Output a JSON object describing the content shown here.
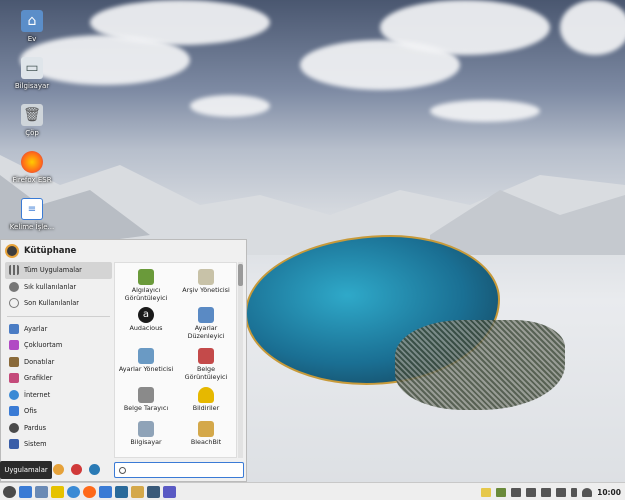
{
  "desktop": {
    "icons": [
      {
        "label": "Ev",
        "icon": "home-folder-icon",
        "color": "#5b8ec9"
      },
      {
        "label": "Bilgisayar",
        "icon": "computer-icon",
        "color": "#8fa3b8"
      },
      {
        "label": "Çöp",
        "icon": "trash-icon",
        "color": "#a9b1b8"
      },
      {
        "label": "Firefox ESR",
        "icon": "firefox-icon",
        "color": "#ff6a1a"
      },
      {
        "label": "Kelime İşle...",
        "icon": "document-icon",
        "color": "#3a7bd5"
      }
    ]
  },
  "menu": {
    "title": "Kütüphane",
    "top_categories": [
      {
        "label": "Tüm Uygulamalar",
        "icon": "grid-icon",
        "selected": true
      },
      {
        "label": "Sık kullanılanlar",
        "icon": "star-icon",
        "selected": false
      },
      {
        "label": "Son Kullanılanlar",
        "icon": "clock-icon",
        "selected": false
      }
    ],
    "categories": [
      {
        "label": "Ayarlar",
        "icon": "settings-icon",
        "color": "#4a7cc4"
      },
      {
        "label": "Çokluortam",
        "icon": "multimedia-icon",
        "color": "#b14ac4"
      },
      {
        "label": "Donatılar",
        "icon": "accessories-icon",
        "color": "#8a6a3a"
      },
      {
        "label": "Grafikler",
        "icon": "graphics-icon",
        "color": "#c44a7a"
      },
      {
        "label": "İnternet",
        "icon": "internet-icon",
        "color": "#3a8ad5"
      },
      {
        "label": "Ofis",
        "icon": "office-icon",
        "color": "#3a7bd5"
      },
      {
        "label": "Pardus",
        "icon": "pardus-icon",
        "color": "#4a4a4a"
      },
      {
        "label": "Sistem",
        "icon": "system-icon",
        "color": "#3a5ea8"
      }
    ],
    "apps": [
      {
        "label": "Algılayıcı Görüntüleyici",
        "icon": "sensor-viewer-icon",
        "color": "#6a9a3a"
      },
      {
        "label": "Arşiv Yöneticisi",
        "icon": "archive-manager-icon",
        "color": "#c8c2a8"
      },
      {
        "label": "Audacious",
        "icon": "audacious-icon",
        "color": "#1a1a1a"
      },
      {
        "label": "Ayarlar Düzenleyici",
        "icon": "settings-editor-icon",
        "color": "#5a8ac4"
      },
      {
        "label": "Ayarlar Yöneticisi",
        "icon": "settings-manager-icon",
        "color": "#6a9ac4"
      },
      {
        "label": "Belge Görüntüleyici",
        "icon": "document-viewer-icon",
        "color": "#c44a4a"
      },
      {
        "label": "Belge Tarayıcı",
        "icon": "document-scanner-icon",
        "color": "#8a8a8a"
      },
      {
        "label": "Bildiriler",
        "icon": "notifications-icon",
        "color": "#e6b800"
      },
      {
        "label": "Bilgisayar",
        "icon": "computer-app-icon",
        "color": "#8fa3b8"
      },
      {
        "label": "BleachBit",
        "icon": "bleachbit-icon",
        "color": "#d4a84a"
      }
    ],
    "search_placeholder": "",
    "tooltip": "Uygulamalar"
  },
  "taskbar": {
    "clock": "10:00",
    "launchers": [
      {
        "icon": "pardus-menu-icon",
        "color": "#4a4a4a"
      },
      {
        "icon": "show-desktop-icon",
        "color": "#3a7bd5"
      },
      {
        "icon": "file-manager-icon",
        "color": "#6a8ab5"
      },
      {
        "icon": "mail-icon",
        "color": "#e6c200"
      },
      {
        "icon": "web-browser-icon",
        "color": "#3a8ad5"
      },
      {
        "icon": "firefox-icon",
        "color": "#ff6a1a"
      },
      {
        "icon": "text-editor-icon",
        "color": "#3a7bd5"
      },
      {
        "icon": "terminal-icon",
        "color": "#2a6a9a"
      },
      {
        "icon": "stack-icon",
        "color": "#d4a84a"
      },
      {
        "icon": "archive-icon",
        "color": "#3a5a7a"
      },
      {
        "icon": "teams-icon",
        "color": "#5a5ac4"
      }
    ],
    "tray_icons": [
      "note-icon",
      "calculator-icon",
      "display-icon",
      "mail-icon",
      "audio-icon",
      "volume-icon",
      "battery-icon",
      "notification-bell-icon"
    ]
  }
}
